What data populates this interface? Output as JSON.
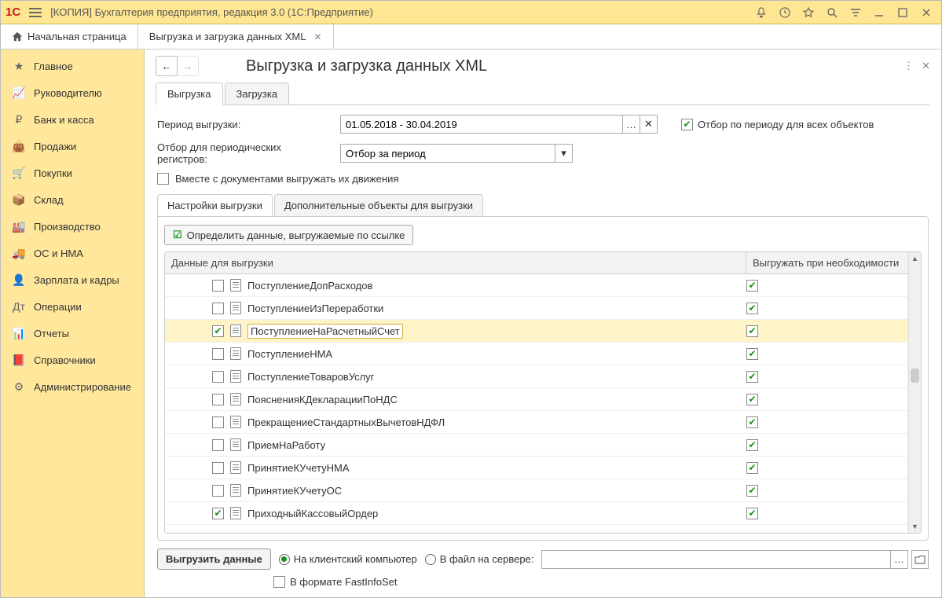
{
  "window": {
    "title": "[КОПИЯ] Бухгалтерия предприятия, редакция 3.0  (1С:Предприятие)"
  },
  "nav_tabs": {
    "home": "Начальная страница",
    "tab1": "Выгрузка и загрузка данных XML"
  },
  "sidebar": {
    "items": [
      {
        "label": "Главное",
        "icon": "star"
      },
      {
        "label": "Руководителю",
        "icon": "chart"
      },
      {
        "label": "Банк и касса",
        "icon": "coin"
      },
      {
        "label": "Продажи",
        "icon": "bag"
      },
      {
        "label": "Покупки",
        "icon": "cart"
      },
      {
        "label": "Склад",
        "icon": "box"
      },
      {
        "label": "Производство",
        "icon": "factory"
      },
      {
        "label": "ОС и НМА",
        "icon": "truck"
      },
      {
        "label": "Зарплата и кадры",
        "icon": "person"
      },
      {
        "label": "Операции",
        "icon": "ops"
      },
      {
        "label": "Отчеты",
        "icon": "bars"
      },
      {
        "label": "Справочники",
        "icon": "book"
      },
      {
        "label": "Администрирование",
        "icon": "gear"
      }
    ]
  },
  "main": {
    "title": "Выгрузка и загрузка данных XML",
    "tabs": {
      "export": "Выгрузка",
      "import": "Загрузка"
    },
    "period_label": "Период выгрузки:",
    "period_value": "01.05.2018 - 30.04.2019",
    "period_filter_all": "Отбор по периоду для всех объектов",
    "reg_filter_label": "Отбор для периодических регистров:",
    "reg_filter_value": "Отбор за период",
    "with_movements": "Вместе с документами выгружать их движения",
    "inner_tabs": {
      "settings": "Настройки выгрузки",
      "extra": "Дополнительные объекты для выгрузки"
    },
    "detect_btn": "Определить данные, выгружаемые по ссылке",
    "grid": {
      "col1": "Данные для выгрузки",
      "col2": "Выгружать при необходимости",
      "rows": [
        {
          "name": "ПоступлениеДопРасходов",
          "chk": false,
          "req": true
        },
        {
          "name": "ПоступлениеИзПереработки",
          "chk": false,
          "req": true
        },
        {
          "name": "ПоступлениеНаРасчетныйСчет",
          "chk": true,
          "req": true,
          "selected": true
        },
        {
          "name": "ПоступлениеНМА",
          "chk": false,
          "req": true
        },
        {
          "name": "ПоступлениеТоваровУслуг",
          "chk": false,
          "req": true
        },
        {
          "name": "ПоясненияКДекларацииПоНДС",
          "chk": false,
          "req": true
        },
        {
          "name": "ПрекращениеСтандартныхВычетовНДФЛ",
          "chk": false,
          "req": true
        },
        {
          "name": "ПриемНаРаботу",
          "chk": false,
          "req": true
        },
        {
          "name": "ПринятиеКУчетуНМА",
          "chk": false,
          "req": true
        },
        {
          "name": "ПринятиеКУчетуОС",
          "chk": false,
          "req": true
        },
        {
          "name": "ПриходныйКассовыйОрдер",
          "chk": true,
          "req": true
        }
      ]
    },
    "footer": {
      "export_btn": "Выгрузить данные",
      "radio_client": "На клиентский компьютер",
      "radio_server": "В файл на сервере:",
      "fastinfoset": "В формате FastInfoSet"
    }
  },
  "icons": {
    "star": "★",
    "chart": "📈",
    "coin": "₽",
    "bag": "👜",
    "cart": "🛒",
    "box": "📦",
    "factory": "🏭",
    "truck": "🚚",
    "person": "👤",
    "ops": "Дт",
    "bars": "📊",
    "book": "📕",
    "gear": "⚙"
  }
}
